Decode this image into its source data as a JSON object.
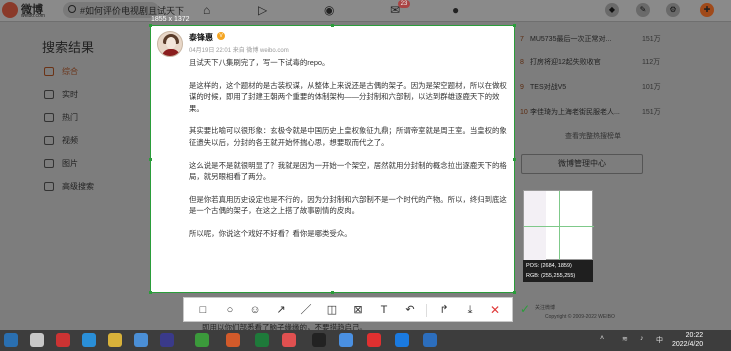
{
  "weibo": {
    "logo_text": "微博",
    "logo_sub": "weibo.com",
    "search_text": "#如何评价电视剧且试天下"
  },
  "header": {
    "messages_badge": "23"
  },
  "sidebar": {
    "title": "搜索结果",
    "items": [
      {
        "label": "综合",
        "icon": "grid-icon"
      },
      {
        "label": "实时",
        "icon": "clock-icon"
      },
      {
        "label": "热门",
        "icon": "fire-icon"
      },
      {
        "label": "视频",
        "icon": "video-icon"
      },
      {
        "label": "图片",
        "icon": "image-icon"
      },
      {
        "label": "高级搜索",
        "icon": "filter-icon"
      }
    ]
  },
  "hot_list": {
    "items": [
      {
        "rank": "7",
        "text": "MU5735最后一次正常对...",
        "count": "151万"
      },
      {
        "rank": "8",
        "text": "打房将迎12起失败收官",
        "count": "112万"
      },
      {
        "rank": "9",
        "text": "TES对战V5",
        "count": "101万"
      },
      {
        "rank": "10",
        "text": "李佳琦为上海老街民服老人...",
        "count": "151万"
      }
    ],
    "more_link": "查看完整热搜榜单",
    "manager_button": "微博管理中心"
  },
  "footer": {
    "about": "关注微博",
    "copyright": "Copyright © 2009-2022 WEIBO"
  },
  "screenshot": {
    "dimensions": "1855 x 1372",
    "post": {
      "author": "泰锋惠",
      "vip_badge": "V",
      "meta": "04月19日 22:01  来自 微博 weibo.com",
      "paragraphs": [
        "且试天下八集刷完了，写一下试毒的repo。",
        "是这样的，这个题材的是古装权谋，从整体上来说还是古偶的架子。因为是架空题材，所以在做权谋的时候，即用了封建王朝两个重要的体制架构——分封制和六部制，以达到群雄逐鹿天下的效果。",
        "其实要比喻可以很形象：玄极令就是中国历史上皇权象征九鼎；所谓帝室就是周王室。当皇权的象征遗失以后，分封的各王就开始怀揣心思，想要取而代之了。",
        "这么说是不是就很明显了？我就是因为一开始一个架空，居然就用分封制的概念拉出逐鹿天下的格局，就另眼相看了两分。",
        "但是你若真用历史设定也是不行的，因为分封制和六部制不是一个时代的产物。所以，终归到底这是一个古偶的架子，在这之上搭了故事剧情的皮肉。",
        "所以呢，你说这个戏好不好看？看你是哪类受众。"
      ]
    },
    "magnifier": {
      "pos_line": "POS: (2684, 1859)",
      "rgb_line": "RGB: (255,255,255)"
    },
    "below_text": "即用以你们部悉看了脑子缘缘的，不要措趋启己。"
  },
  "taskbar": {
    "time": "20:22",
    "date": "2022/4/20",
    "lang": "中"
  }
}
